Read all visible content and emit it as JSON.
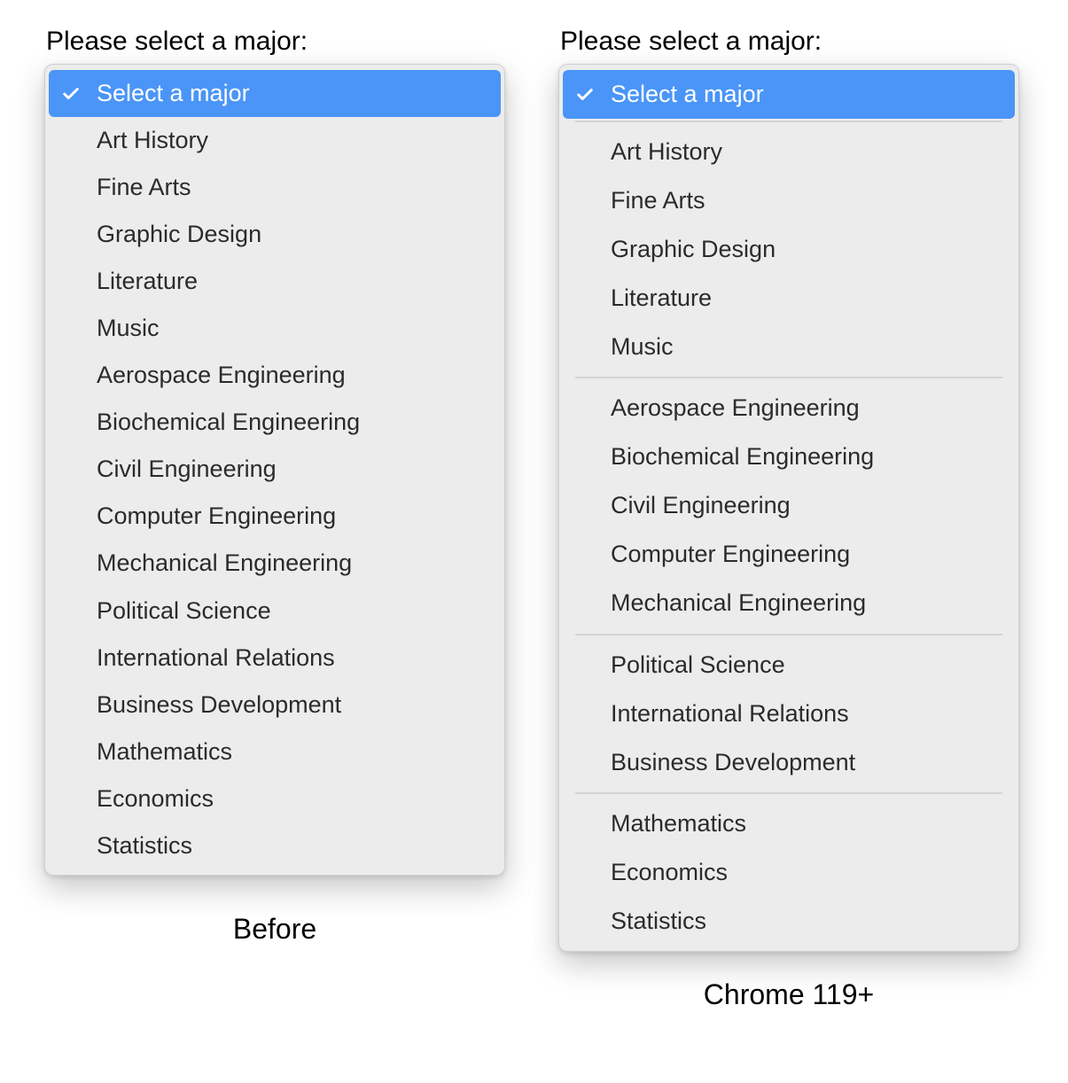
{
  "heading_left": "Please select a major:",
  "heading_right": "Please select a major:",
  "caption_left": "Before",
  "caption_right": "Chrome 119+",
  "selected_label": "Select a major",
  "options_flat": [
    "Art History",
    "Fine Arts",
    "Graphic Design",
    "Literature",
    "Music",
    "Aerospace Engineering",
    "Biochemical Engineering",
    "Civil Engineering",
    "Computer Engineering",
    "Mechanical Engineering",
    "Political Science",
    "International Relations",
    "Business Development",
    "Mathematics",
    "Economics",
    "Statistics"
  ],
  "groups": [
    {
      "items": [
        "Art History",
        "Fine Arts",
        "Graphic Design",
        "Literature",
        "Music"
      ]
    },
    {
      "items": [
        "Aerospace Engineering",
        "Biochemical Engineering",
        "Civil Engineering",
        "Computer Engineering",
        "Mechanical Engineering"
      ]
    },
    {
      "items": [
        "Political Science",
        "International Relations",
        "Business Development"
      ]
    },
    {
      "items": [
        "Mathematics",
        "Economics",
        "Statistics"
      ]
    }
  ],
  "colors": {
    "highlight": "#4a95f7",
    "menu_bg": "#ececec",
    "separator": "#d4d4d4"
  }
}
